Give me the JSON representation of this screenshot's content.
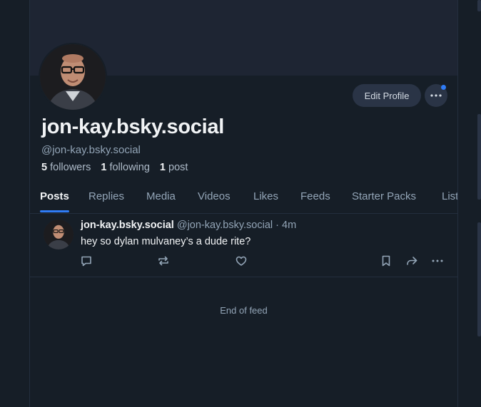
{
  "profile": {
    "display_name": "jon-kay.bsky.social",
    "handle": "@jon-kay.bsky.social",
    "followers_count": "5",
    "followers_label": "followers",
    "following_count": "1",
    "following_label": "following",
    "posts_count": "1",
    "posts_label": "post",
    "edit_button": "Edit Profile",
    "more_icon": "ellipsis-icon"
  },
  "tabs": [
    {
      "label": "Posts",
      "active": true
    },
    {
      "label": "Replies"
    },
    {
      "label": "Media"
    },
    {
      "label": "Videos"
    },
    {
      "label": "Likes"
    },
    {
      "label": "Feeds"
    },
    {
      "label": "Starter Packs"
    },
    {
      "label": "Lists"
    }
  ],
  "post": {
    "author": "jon-kay.bsky.social",
    "handle": "@jon-kay.bsky.social",
    "separator": "·",
    "time": "4m",
    "text": "hey so dylan mulvaney’s a dude rite?",
    "actions": [
      "reply-icon",
      "repost-icon",
      "like-icon",
      "bookmark-icon",
      "share-icon",
      "more-icon"
    ]
  },
  "feed": {
    "end_text": "End of feed"
  },
  "colors": {
    "accent": "#2f7cf6",
    "background": "#161e27",
    "banner": "#1e2533"
  }
}
